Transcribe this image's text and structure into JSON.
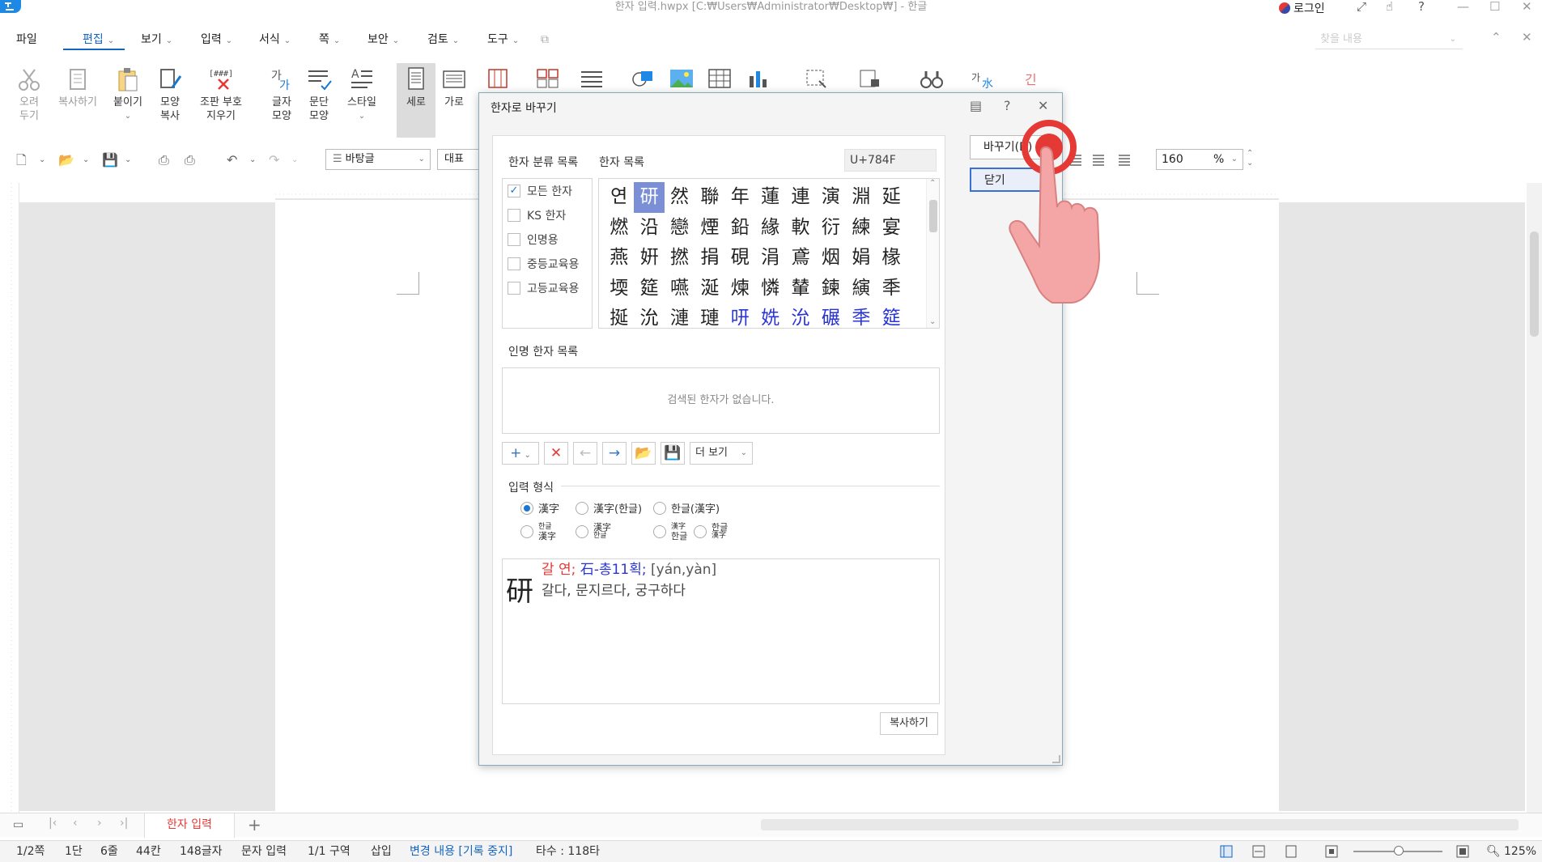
{
  "window": {
    "title": "한자 입력.hwpx [C:₩Users₩Administrator₩Desktop₩] - 한글",
    "login_label": "로그인"
  },
  "menu": {
    "items": [
      {
        "label": "파일"
      },
      {
        "label": "편집"
      },
      {
        "label": "보기"
      },
      {
        "label": "입력"
      },
      {
        "label": "서식"
      },
      {
        "label": "쪽"
      },
      {
        "label": "보안"
      },
      {
        "label": "검토"
      },
      {
        "label": "도구"
      }
    ],
    "find_placeholder": "찾을 내용"
  },
  "ribbon": {
    "cut": [
      "오려",
      "두기"
    ],
    "copy": [
      "복사하기"
    ],
    "paste": [
      "붙이기"
    ],
    "format_copy": [
      "모양",
      "복사"
    ],
    "clear_codes": [
      "조판 부호",
      "지우기"
    ],
    "char_shape": [
      "글자",
      "모양"
    ],
    "para_shape": [
      "문단",
      "모양"
    ],
    "style": [
      "스타일"
    ],
    "vertical": [
      "세로"
    ],
    "horizontal": [
      "가로"
    ]
  },
  "toolbar": {
    "style_value": "바탕글",
    "font_value": "대표",
    "zoom_value": "160",
    "zoom_unit": "%"
  },
  "document": {
    "tab_label": "한자 입력"
  },
  "status": {
    "page": "1/2쪽",
    "column": "1단",
    "line": "6줄",
    "col_chars": "44칸",
    "char_count": "148글자",
    "mode": "문자 입력",
    "section": "1/1 구역",
    "insert": "삽입",
    "track_changes": "변경 내용 [기록 중지]",
    "typing_speed": "타수 : 118타",
    "zoom": "125%"
  },
  "dialog": {
    "title": "한자로 바꾸기",
    "category_label": "한자 분류 목록",
    "hanja_list_label": "한자 목록",
    "unicode": "U+784F",
    "categories": [
      {
        "label": "모든 한자",
        "checked": true
      },
      {
        "label": "KS 한자",
        "checked": false
      },
      {
        "label": "인명용",
        "checked": false
      },
      {
        "label": "중등교육용",
        "checked": false
      },
      {
        "label": "고등교육용",
        "checked": false
      }
    ],
    "hanja_rows": [
      [
        "연",
        "研",
        "然",
        "聯",
        "年",
        "蓮",
        "連",
        "演",
        "淵",
        "延"
      ],
      [
        "燃",
        "沿",
        "戀",
        "煙",
        "鉛",
        "緣",
        "軟",
        "衍",
        "練",
        "宴"
      ],
      [
        "燕",
        "姸",
        "撚",
        "捐",
        "硯",
        "涓",
        "鳶",
        "烟",
        "娟",
        "椽"
      ],
      [
        "堧",
        "筵",
        "嚥",
        "涎",
        "煉",
        "憐",
        "輦",
        "鍊",
        "縯",
        "秊"
      ],
      [
        "挻",
        "沇",
        "漣",
        "璉",
        "咞",
        "姺",
        "沇",
        "碾",
        "秊",
        "筵"
      ]
    ],
    "selected_hanja": "研",
    "name_hanja_label": "인명 한자 목록",
    "name_hanja_empty": "검색된 한자가 없습니다.",
    "more_label": "더 보기",
    "input_format_label": "입력 형식",
    "formats_row1": [
      "漢字",
      "漢字(한글)",
      "한글(漢字)"
    ],
    "formats_row2": [
      [
        "한글",
        "漢字"
      ],
      [
        "漢字",
        "한글"
      ],
      [
        "漢字",
        "한글"
      ],
      [
        "한글",
        "漢字"
      ]
    ],
    "info": {
      "hanja": "研",
      "reading": "갈 연;",
      "radical": "石-총11획;",
      "pinyin": "[yán,yàn]",
      "meaning": "갈다, 문지르다, 궁구하다"
    },
    "copy_label": "복사하기",
    "replace_label": "바꾸기(D)",
    "close_label": "닫기"
  },
  "colors": {
    "accent": "#1565c0",
    "selection": "#7b8fd6",
    "pointer_red": "#e53935",
    "hand_fill": "#f4a6a6"
  }
}
